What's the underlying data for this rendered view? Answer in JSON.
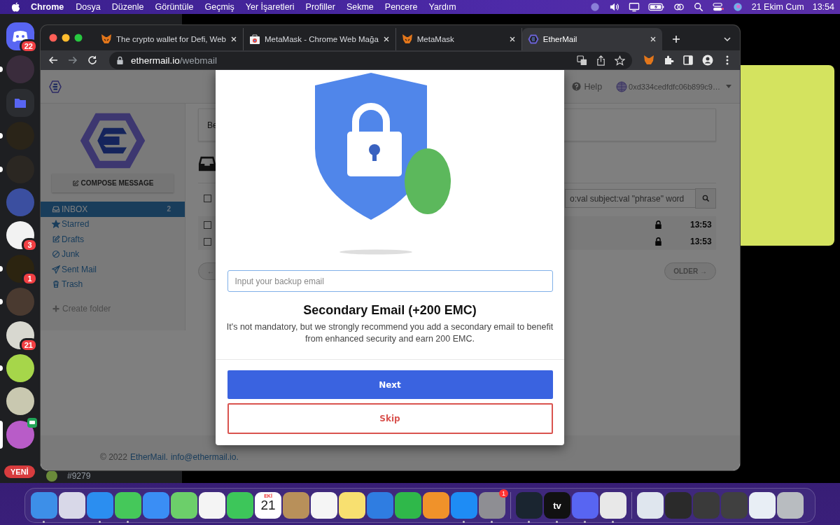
{
  "menu_bar": {
    "app": "Chrome",
    "items": [
      "Dosya",
      "Düzenle",
      "Görüntüle",
      "Geçmiş",
      "Yer İşaretleri",
      "Profiller",
      "Sekme",
      "Pencere",
      "Yardım"
    ],
    "date": "21 Ekim Cum",
    "time": "13:54"
  },
  "discord": {
    "servers": [
      {
        "kind": "logo",
        "color": "#5865f2",
        "badge": "22",
        "unread": false,
        "selected": false,
        "live": false
      },
      {
        "kind": "avatar",
        "color": "#3a2c3c",
        "unread": true,
        "selected": false,
        "live": false
      },
      {
        "kind": "folder",
        "color": "#5865f2",
        "unread": false,
        "selected": false,
        "live": false
      },
      {
        "kind": "avatar",
        "color": "#2a2418",
        "unread": true,
        "selected": false,
        "live": false
      },
      {
        "kind": "avatar",
        "color": "#2b2722",
        "unread": true,
        "selected": false,
        "live": false
      },
      {
        "kind": "avatar",
        "color": "#3b4fa0",
        "unread": false,
        "selected": false,
        "live": false
      },
      {
        "kind": "avatar",
        "color": "#f2f2f2",
        "badge": "3",
        "unread": false,
        "selected": false,
        "live": false
      },
      {
        "kind": "avatar",
        "color": "#2c2410",
        "badge": "1",
        "unread": true,
        "selected": false,
        "live": false
      },
      {
        "kind": "avatar",
        "color": "#4a3a30",
        "unread": true,
        "selected": false,
        "live": false
      },
      {
        "kind": "avatar",
        "color": "#d8d8d0",
        "badge": "21",
        "unread": false,
        "selected": false,
        "live": false
      },
      {
        "kind": "avatar",
        "color": "#a6d64a",
        "unread": true,
        "selected": false,
        "live": false
      },
      {
        "kind": "avatar",
        "color": "#c9c8b0",
        "unread": false,
        "selected": false,
        "live": false
      },
      {
        "kind": "avatar",
        "color": "#b85cc8",
        "unread": false,
        "selected": true,
        "live": true
      }
    ],
    "new_label": "YENİ",
    "user_tag": "#9279"
  },
  "browser": {
    "tabs": [
      {
        "title": "The crypto wallet for Defi, Web",
        "kind": "fox",
        "selected": false
      },
      {
        "title": "MetaMask - Chrome Web Mağa",
        "kind": "store",
        "selected": false
      },
      {
        "title": "MetaMask",
        "kind": "fox",
        "selected": false
      },
      {
        "title": "EtherMail",
        "kind": "hexagon",
        "selected": true
      }
    ],
    "url": {
      "host": "ethermail.io",
      "path": "/webmail"
    }
  },
  "webmail": {
    "help": "Help",
    "account": "0xd334cedfdfc06b899c9…",
    "compose": "COMPOSE MESSAGE",
    "folders": [
      {
        "label": "INBOX",
        "kind": "inbox",
        "selected": true,
        "count": "2"
      },
      {
        "label": "Starred",
        "kind": "star",
        "selected": false
      },
      {
        "label": "Drafts",
        "kind": "edit",
        "selected": false
      },
      {
        "label": "Junk",
        "kind": "ban",
        "selected": false
      },
      {
        "label": "Sent Mail",
        "kind": "send",
        "selected": false
      },
      {
        "label": "Trash",
        "kind": "trash",
        "selected": false
      }
    ],
    "create_folder": "Create folder",
    "banner": "Be",
    "select_all_checked": false,
    "search_placeholder": "o:val subject:val \"phrase\" word",
    "rows": [
      {
        "checked": false,
        "locked": true,
        "time": "13:53"
      },
      {
        "checked": false,
        "locked": true,
        "time": "13:53"
      }
    ],
    "newer": "←",
    "older": "OLDER →",
    "footer": {
      "copyright": "© 2022",
      "brand": "EtherMail.",
      "email": "info@ethermail.io."
    }
  },
  "modal": {
    "placeholder": "Input your backup email",
    "title": "Secondary Email (+200 EMC)",
    "body": "It's not mandatory, but we strongly recommend you add a secondary email to benefit from enhanced security and earn 200 EMC.",
    "next": "Next",
    "skip": "Skip"
  },
  "dock": {
    "items": [
      {
        "kind": "app",
        "color": "#3d8fe8",
        "running": true
      },
      {
        "kind": "app",
        "color": "#d8d8e8",
        "running": false
      },
      {
        "kind": "app",
        "color": "#2b8ef0",
        "running": true
      },
      {
        "kind": "app",
        "color": "#45c85a",
        "running": true
      },
      {
        "kind": "app",
        "color": "#3a8ef5",
        "running": false
      },
      {
        "kind": "app",
        "color": "#6ccf6a",
        "running": false
      },
      {
        "kind": "app",
        "color": "#f4f4f4",
        "running": false
      },
      {
        "kind": "app",
        "color": "#3dc65a",
        "running": false
      },
      {
        "kind": "calendar",
        "color": "#ffffff",
        "month": "EKİ",
        "day": "21",
        "running": false
      },
      {
        "kind": "app",
        "color": "#b8905a",
        "running": false
      },
      {
        "kind": "app",
        "color": "#f5f5f5",
        "running": false
      },
      {
        "kind": "app",
        "color": "#f8e070",
        "running": false
      },
      {
        "kind": "app",
        "color": "#2f7de1",
        "running": false
      },
      {
        "kind": "app",
        "color": "#2fb84a",
        "running": false
      },
      {
        "kind": "app",
        "color": "#f0922a",
        "running": false
      },
      {
        "kind": "app",
        "color": "#1e8cf5",
        "running": true
      },
      {
        "kind": "app",
        "color": "#8e8e93",
        "running": true,
        "badge": "1"
      },
      {
        "kind": "separator"
      },
      {
        "kind": "app",
        "color": "#1a2530",
        "running": true
      },
      {
        "kind": "tv",
        "color": "#111111",
        "label": "tv",
        "running": true
      },
      {
        "kind": "app",
        "color": "#5865f2",
        "running": true
      },
      {
        "kind": "app",
        "color": "#e8e8e8",
        "running": true
      },
      {
        "kind": "separator"
      },
      {
        "kind": "app",
        "color": "#dfe6ee",
        "running": false
      },
      {
        "kind": "app",
        "color": "#2a2a2a",
        "running": false
      },
      {
        "kind": "app",
        "color": "#3a3a3a",
        "running": false
      },
      {
        "kind": "app",
        "color": "#404040",
        "running": false
      },
      {
        "kind": "app",
        "color": "#e8eef5",
        "running": false
      },
      {
        "kind": "app",
        "color": "#b8bcc0",
        "running": false
      }
    ]
  }
}
